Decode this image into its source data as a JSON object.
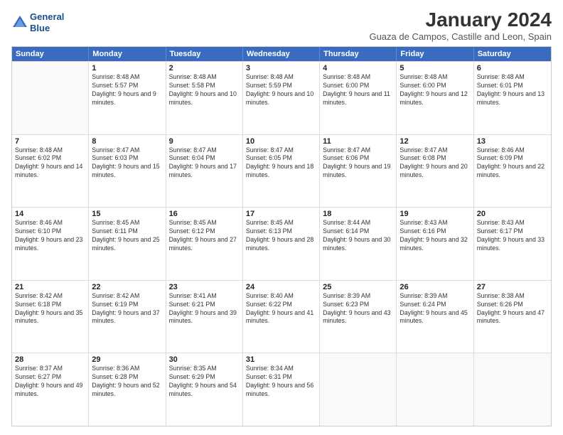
{
  "header": {
    "logo_line1": "General",
    "logo_line2": "Blue",
    "title": "January 2024",
    "subtitle": "Guaza de Campos, Castille and Leon, Spain"
  },
  "days_of_week": [
    "Sunday",
    "Monday",
    "Tuesday",
    "Wednesday",
    "Thursday",
    "Friday",
    "Saturday"
  ],
  "rows": [
    [
      {
        "day": "",
        "rise": "",
        "set": "",
        "daylight": ""
      },
      {
        "day": "1",
        "rise": "Sunrise: 8:48 AM",
        "set": "Sunset: 5:57 PM",
        "daylight": "Daylight: 9 hours and 9 minutes."
      },
      {
        "day": "2",
        "rise": "Sunrise: 8:48 AM",
        "set": "Sunset: 5:58 PM",
        "daylight": "Daylight: 9 hours and 10 minutes."
      },
      {
        "day": "3",
        "rise": "Sunrise: 8:48 AM",
        "set": "Sunset: 5:59 PM",
        "daylight": "Daylight: 9 hours and 10 minutes."
      },
      {
        "day": "4",
        "rise": "Sunrise: 8:48 AM",
        "set": "Sunset: 6:00 PM",
        "daylight": "Daylight: 9 hours and 11 minutes."
      },
      {
        "day": "5",
        "rise": "Sunrise: 8:48 AM",
        "set": "Sunset: 6:00 PM",
        "daylight": "Daylight: 9 hours and 12 minutes."
      },
      {
        "day": "6",
        "rise": "Sunrise: 8:48 AM",
        "set": "Sunset: 6:01 PM",
        "daylight": "Daylight: 9 hours and 13 minutes."
      }
    ],
    [
      {
        "day": "7",
        "rise": "Sunrise: 8:48 AM",
        "set": "Sunset: 6:02 PM",
        "daylight": "Daylight: 9 hours and 14 minutes."
      },
      {
        "day": "8",
        "rise": "Sunrise: 8:47 AM",
        "set": "Sunset: 6:03 PM",
        "daylight": "Daylight: 9 hours and 15 minutes."
      },
      {
        "day": "9",
        "rise": "Sunrise: 8:47 AM",
        "set": "Sunset: 6:04 PM",
        "daylight": "Daylight: 9 hours and 17 minutes."
      },
      {
        "day": "10",
        "rise": "Sunrise: 8:47 AM",
        "set": "Sunset: 6:05 PM",
        "daylight": "Daylight: 9 hours and 18 minutes."
      },
      {
        "day": "11",
        "rise": "Sunrise: 8:47 AM",
        "set": "Sunset: 6:06 PM",
        "daylight": "Daylight: 9 hours and 19 minutes."
      },
      {
        "day": "12",
        "rise": "Sunrise: 8:47 AM",
        "set": "Sunset: 6:08 PM",
        "daylight": "Daylight: 9 hours and 20 minutes."
      },
      {
        "day": "13",
        "rise": "Sunrise: 8:46 AM",
        "set": "Sunset: 6:09 PM",
        "daylight": "Daylight: 9 hours and 22 minutes."
      }
    ],
    [
      {
        "day": "14",
        "rise": "Sunrise: 8:46 AM",
        "set": "Sunset: 6:10 PM",
        "daylight": "Daylight: 9 hours and 23 minutes."
      },
      {
        "day": "15",
        "rise": "Sunrise: 8:45 AM",
        "set": "Sunset: 6:11 PM",
        "daylight": "Daylight: 9 hours and 25 minutes."
      },
      {
        "day": "16",
        "rise": "Sunrise: 8:45 AM",
        "set": "Sunset: 6:12 PM",
        "daylight": "Daylight: 9 hours and 27 minutes."
      },
      {
        "day": "17",
        "rise": "Sunrise: 8:45 AM",
        "set": "Sunset: 6:13 PM",
        "daylight": "Daylight: 9 hours and 28 minutes."
      },
      {
        "day": "18",
        "rise": "Sunrise: 8:44 AM",
        "set": "Sunset: 6:14 PM",
        "daylight": "Daylight: 9 hours and 30 minutes."
      },
      {
        "day": "19",
        "rise": "Sunrise: 8:43 AM",
        "set": "Sunset: 6:16 PM",
        "daylight": "Daylight: 9 hours and 32 minutes."
      },
      {
        "day": "20",
        "rise": "Sunrise: 8:43 AM",
        "set": "Sunset: 6:17 PM",
        "daylight": "Daylight: 9 hours and 33 minutes."
      }
    ],
    [
      {
        "day": "21",
        "rise": "Sunrise: 8:42 AM",
        "set": "Sunset: 6:18 PM",
        "daylight": "Daylight: 9 hours and 35 minutes."
      },
      {
        "day": "22",
        "rise": "Sunrise: 8:42 AM",
        "set": "Sunset: 6:19 PM",
        "daylight": "Daylight: 9 hours and 37 minutes."
      },
      {
        "day": "23",
        "rise": "Sunrise: 8:41 AM",
        "set": "Sunset: 6:21 PM",
        "daylight": "Daylight: 9 hours and 39 minutes."
      },
      {
        "day": "24",
        "rise": "Sunrise: 8:40 AM",
        "set": "Sunset: 6:22 PM",
        "daylight": "Daylight: 9 hours and 41 minutes."
      },
      {
        "day": "25",
        "rise": "Sunrise: 8:39 AM",
        "set": "Sunset: 6:23 PM",
        "daylight": "Daylight: 9 hours and 43 minutes."
      },
      {
        "day": "26",
        "rise": "Sunrise: 8:39 AM",
        "set": "Sunset: 6:24 PM",
        "daylight": "Daylight: 9 hours and 45 minutes."
      },
      {
        "day": "27",
        "rise": "Sunrise: 8:38 AM",
        "set": "Sunset: 6:26 PM",
        "daylight": "Daylight: 9 hours and 47 minutes."
      }
    ],
    [
      {
        "day": "28",
        "rise": "Sunrise: 8:37 AM",
        "set": "Sunset: 6:27 PM",
        "daylight": "Daylight: 9 hours and 49 minutes."
      },
      {
        "day": "29",
        "rise": "Sunrise: 8:36 AM",
        "set": "Sunset: 6:28 PM",
        "daylight": "Daylight: 9 hours and 52 minutes."
      },
      {
        "day": "30",
        "rise": "Sunrise: 8:35 AM",
        "set": "Sunset: 6:29 PM",
        "daylight": "Daylight: 9 hours and 54 minutes."
      },
      {
        "day": "31",
        "rise": "Sunrise: 8:34 AM",
        "set": "Sunset: 6:31 PM",
        "daylight": "Daylight: 9 hours and 56 minutes."
      },
      {
        "day": "",
        "rise": "",
        "set": "",
        "daylight": ""
      },
      {
        "day": "",
        "rise": "",
        "set": "",
        "daylight": ""
      },
      {
        "day": "",
        "rise": "",
        "set": "",
        "daylight": ""
      }
    ]
  ]
}
